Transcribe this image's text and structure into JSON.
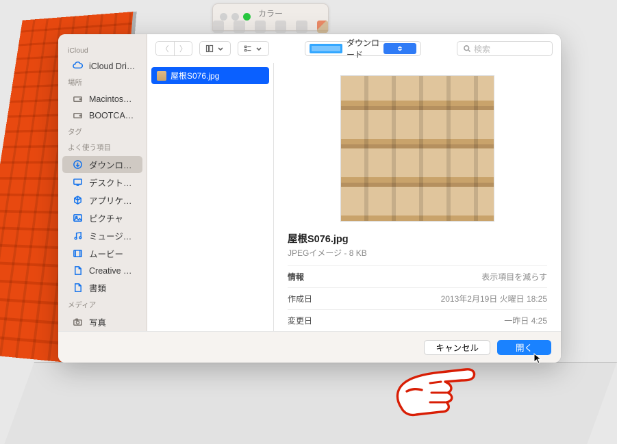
{
  "background": {
    "palette_title": "カラー"
  },
  "dialog": {
    "sidebar": {
      "groups": [
        {
          "label": "iCloud",
          "items": [
            {
              "id": "icloud-drive",
              "label": "iCloud Drive",
              "icon": "cloud-icon"
            }
          ]
        },
        {
          "label": "場所",
          "items": [
            {
              "id": "macintosh-hd",
              "label": "Macintosh…",
              "icon": "hdd-icon"
            },
            {
              "id": "bootcamp",
              "label": "BOOTCAMP",
              "icon": "hdd-icon"
            }
          ]
        },
        {
          "label": "タグ",
          "items": []
        },
        {
          "label": "よく使う項目",
          "items": [
            {
              "id": "downloads",
              "label": "ダウンロード",
              "icon": "download-icon",
              "active": true
            },
            {
              "id": "desktop",
              "label": "デスクトップ",
              "icon": "desktop-icon"
            },
            {
              "id": "applications",
              "label": "アプリケー…",
              "icon": "app-icon"
            },
            {
              "id": "pictures",
              "label": "ピクチャ",
              "icon": "picture-icon"
            },
            {
              "id": "music",
              "label": "ミュージック",
              "icon": "music-icon"
            },
            {
              "id": "movies",
              "label": "ムービー",
              "icon": "movie-icon"
            },
            {
              "id": "creative-cloud",
              "label": "Creative Cl…",
              "icon": "file-icon"
            },
            {
              "id": "documents",
              "label": "書類",
              "icon": "file-icon"
            }
          ]
        },
        {
          "label": "メディア",
          "items": [
            {
              "id": "photos",
              "label": "写真",
              "icon": "camera-icon"
            }
          ]
        }
      ]
    },
    "toolbar": {
      "location_label": "ダウンロード",
      "search_placeholder": "検索"
    },
    "filelist": {
      "items": [
        {
          "name": "屋根S076.jpg"
        }
      ]
    },
    "preview": {
      "filename": "屋根S076.jpg",
      "subtitle": "JPEGイメージ - 8 KB",
      "info_header": "情報",
      "info_header_action": "表示項目を減らす",
      "rows": [
        {
          "k": "作成日",
          "v": "2013年2月19日 火曜日 18:25"
        },
        {
          "k": "変更日",
          "v": "一昨日 4:25"
        }
      ]
    },
    "footer": {
      "cancel": "キャンセル",
      "open": "開く"
    }
  }
}
